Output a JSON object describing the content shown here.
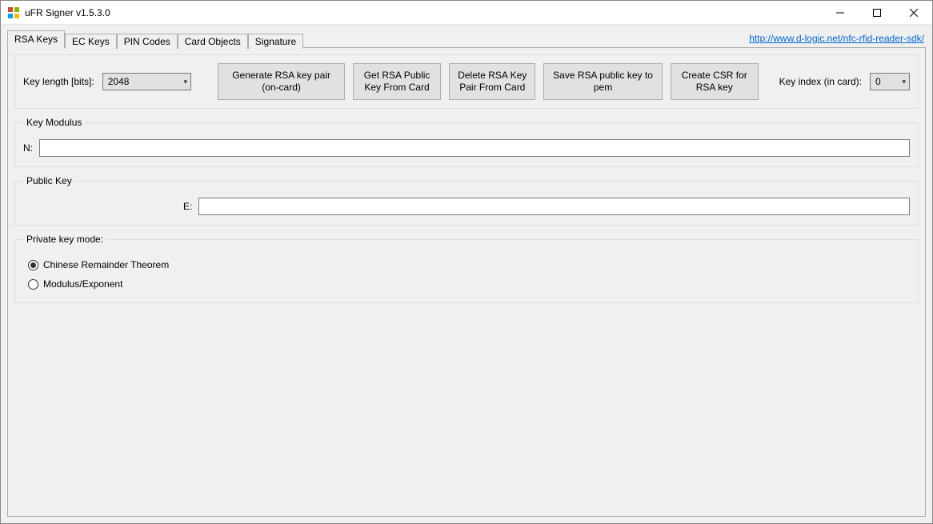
{
  "window": {
    "title": "uFR Signer v1.5.3.0"
  },
  "header_link": "http://www.d-logic.net/nfc-rfid-reader-sdk/",
  "tabs": [
    {
      "label": "RSA Keys",
      "active": true
    },
    {
      "label": "EC Keys"
    },
    {
      "label": "PIN Codes"
    },
    {
      "label": "Card Objects"
    },
    {
      "label": "Signature"
    }
  ],
  "toolbar": {
    "key_length_label": "Key length [bits]:",
    "key_length_value": "2048",
    "generate_btn": "Generate RSA key pair (on-card)",
    "get_pub_btn": "Get RSA Public Key From Card",
    "delete_btn": "Delete RSA Key Pair From Card",
    "save_pem_btn": "Save RSA public key to pem",
    "create_csr_btn": "Create CSR for RSA key",
    "key_index_label": "Key index (in card):",
    "key_index_value": "0"
  },
  "key_modulus": {
    "legend": "Key Modulus",
    "n_label": "N:",
    "n_value": ""
  },
  "public_key": {
    "legend": "Public Key",
    "e_label": "E:",
    "e_value": ""
  },
  "private_key_mode": {
    "legend": "Private key mode:",
    "opt_crt": "Chinese Remainder Theorem",
    "opt_modexp": "Modulus/Exponent",
    "selected": "crt"
  }
}
